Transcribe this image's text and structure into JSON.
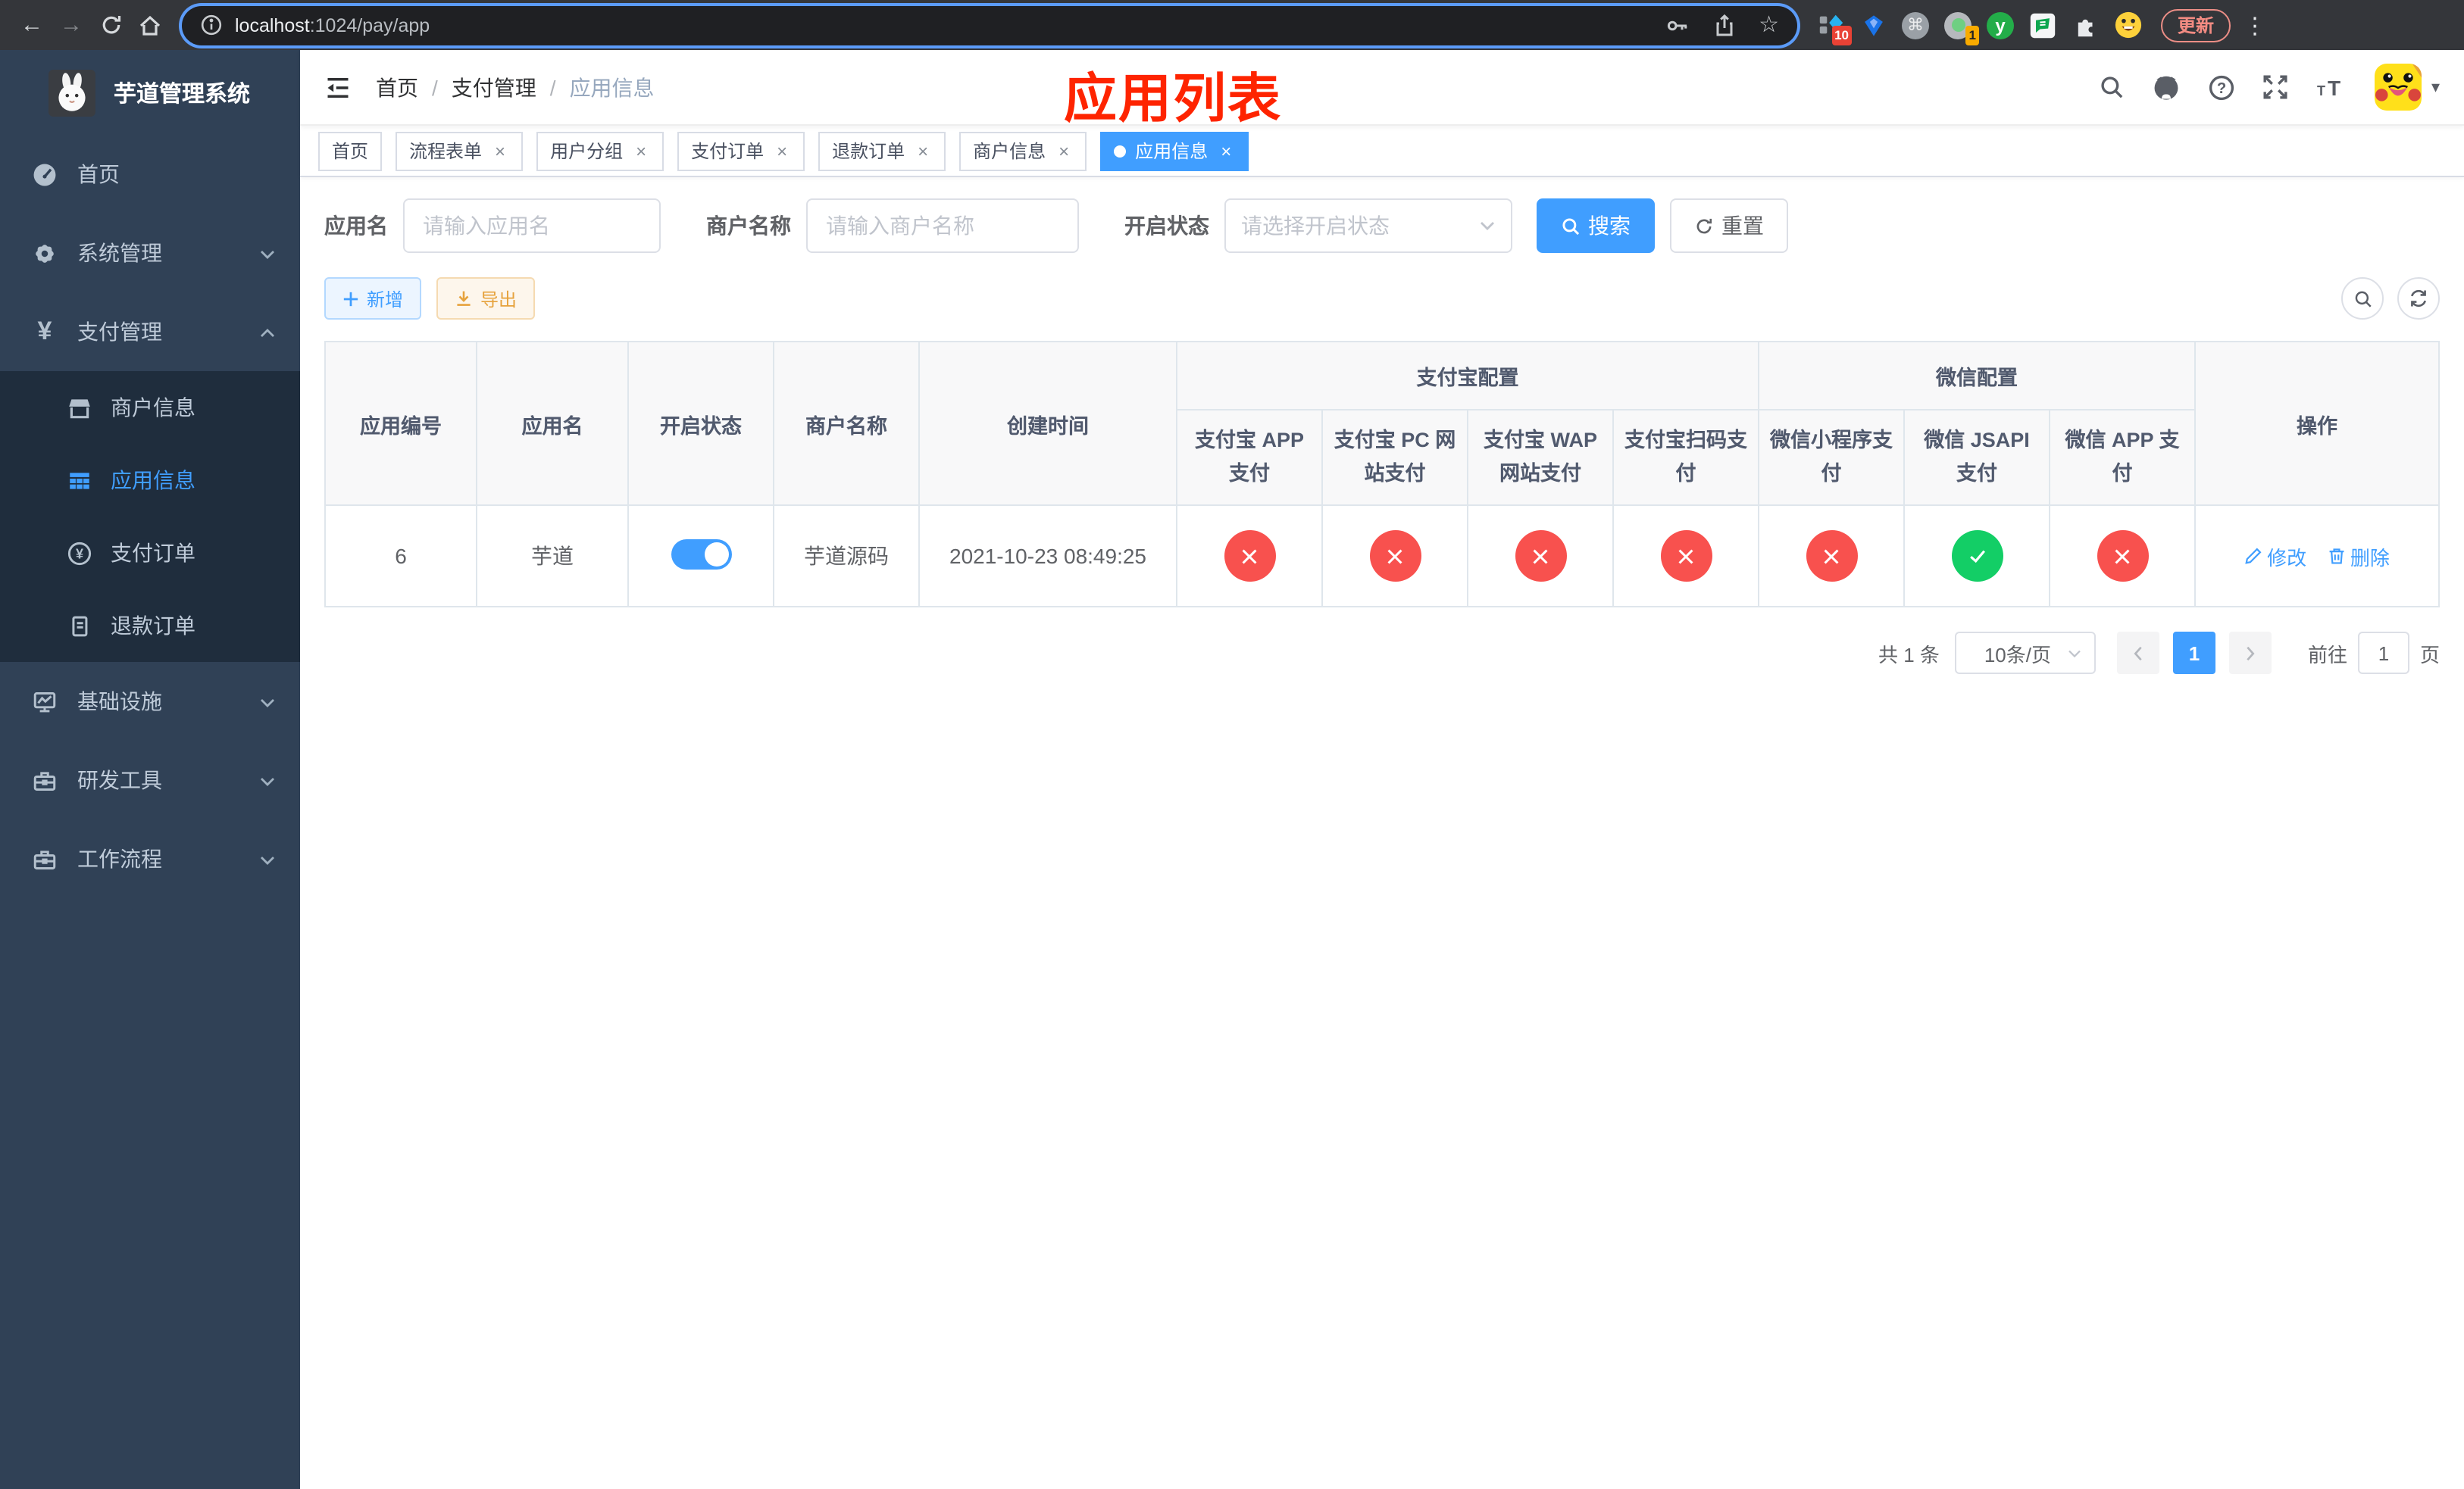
{
  "colors": {
    "accent": "#409eff",
    "success": "#13ce66",
    "danger": "#f8514e",
    "warning": "#e6a23c",
    "annotation": "#fe2400",
    "sidebar_bg": "#304156",
    "submenu_bg": "#1f2d3d"
  },
  "browser": {
    "url_host": "localhost",
    "url_path": ":1024/pay/app",
    "update_label": "更新",
    "extension_badges": {
      "pinned": "10",
      "session": "1"
    }
  },
  "sidebar": {
    "title": "芋道管理系统",
    "menu": [
      {
        "label": "首页"
      },
      {
        "label": "系统管理"
      },
      {
        "label": "支付管理"
      },
      {
        "label": "基础设施"
      },
      {
        "label": "研发工具"
      },
      {
        "label": "工作流程"
      }
    ],
    "submenu": [
      {
        "label": "商户信息"
      },
      {
        "label": "应用信息"
      },
      {
        "label": "支付订单"
      },
      {
        "label": "退款订单"
      }
    ]
  },
  "navbar": {
    "breadcrumb": [
      "首页",
      "支付管理",
      "应用信息"
    ],
    "annotation": "应用列表"
  },
  "tabs": [
    {
      "label": "首页"
    },
    {
      "label": "流程表单"
    },
    {
      "label": "用户分组"
    },
    {
      "label": "支付订单"
    },
    {
      "label": "退款订单"
    },
    {
      "label": "商户信息"
    },
    {
      "label": "应用信息"
    }
  ],
  "filters": {
    "app_name_label": "应用名",
    "app_name_placeholder": "请输入应用名",
    "merchant_label": "商户名称",
    "merchant_placeholder": "请输入商户名称",
    "status_label": "开启状态",
    "status_placeholder": "请选择开启状态",
    "search_label": "搜索",
    "reset_label": "重置"
  },
  "toolbar": {
    "add_label": "新增",
    "export_label": "导出"
  },
  "table": {
    "groups": {
      "alipay": "支付宝配置",
      "wechat": "微信配置"
    },
    "columns": {
      "app_id": "应用编号",
      "app_name": "应用名",
      "status": "开启状态",
      "merchant": "商户名称",
      "created": "创建时间",
      "alipay_app": "支付宝 APP 支付",
      "alipay_pc": "支付宝 PC 网站支付",
      "alipay_wap": "支付宝 WAP 网站支付",
      "alipay_qr": "支付宝扫码支付",
      "wx_lite": "微信小程序支付",
      "wx_jsapi": "微信 JSAPI 支付",
      "wx_app": "微信 APP 支付",
      "actions": "操作"
    },
    "rows": [
      {
        "app_id": "6",
        "app_name": "芋道",
        "status_on": true,
        "merchant": "芋道源码",
        "created": "2021-10-23 08:49:25",
        "pay_channels": {
          "alipay_app": false,
          "alipay_pc": false,
          "alipay_wap": false,
          "alipay_qr": false,
          "wx_lite": false,
          "wx_jsapi": true,
          "wx_app": false
        },
        "edit_label": "修改",
        "delete_label": "删除"
      }
    ]
  },
  "pagination": {
    "total": "共 1 条",
    "page_size": "10条/页",
    "page": "1",
    "goto_label": "前往",
    "goto_value": "1",
    "page_unit": "页"
  }
}
